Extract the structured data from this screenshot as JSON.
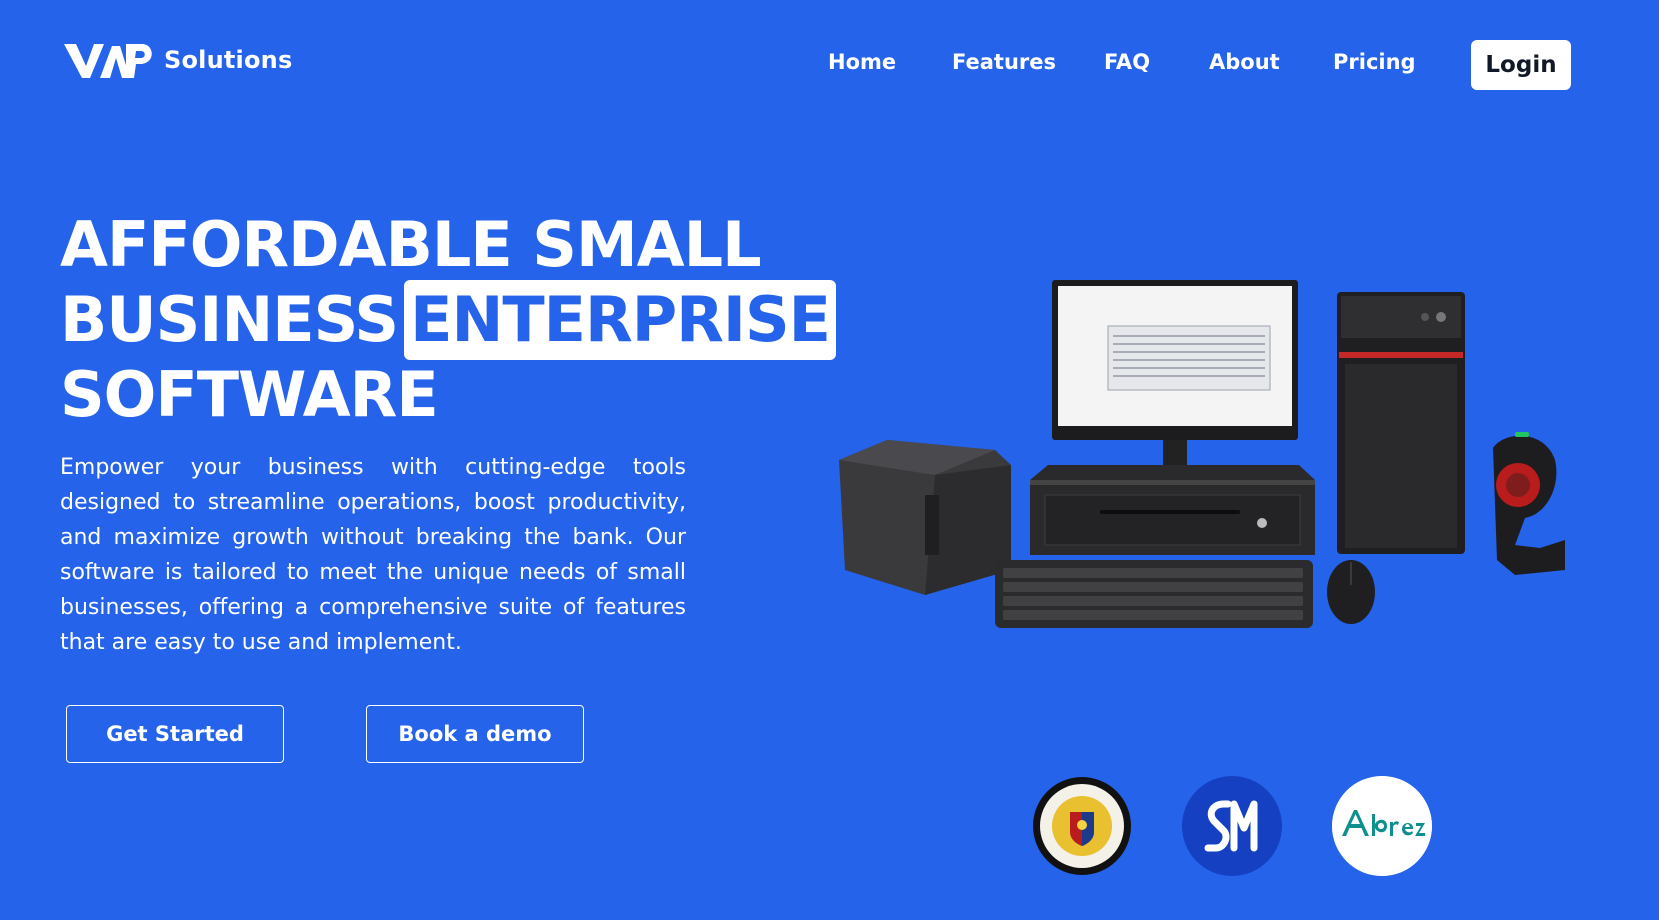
{
  "brand": {
    "name": "Solutions"
  },
  "nav": {
    "items": [
      "Home",
      "Features",
      "FAQ",
      "About",
      "Pricing"
    ],
    "login_label": "Login"
  },
  "hero": {
    "title_line1": "AFFORDABLE SMALL",
    "title_line2_prefix": "BUSINESS",
    "title_line2_highlight": "ENTERPRISE",
    "title_line3": "SOFTWARE",
    "description": "Empower your business with cutting-edge tools designed to streamline operations, boost productivity, and maximize growth without breaking the bank. Our software is tailored to meet the unique needs of small businesses, offering a comprehensive suite of features that are easy to use and implement.",
    "primary_cta": "Get Started",
    "secondary_cta": "Book a demo"
  },
  "partners": [
    {
      "name": "Bureau of Internal Revenue Philippines",
      "icon": "bir-seal-icon"
    },
    {
      "name": "SM",
      "icon": "sm-logo-icon"
    },
    {
      "name": "Abreeza",
      "icon": "abreeza-logo-icon"
    }
  ],
  "colors": {
    "background": "#2563eb",
    "text": "#ffffff",
    "button_bg": "#ffffff"
  }
}
